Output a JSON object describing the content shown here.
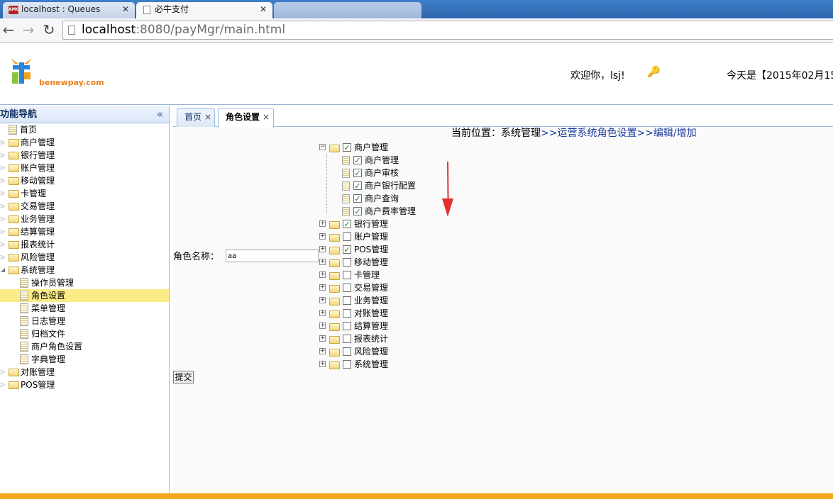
{
  "browser": {
    "tabs": [
      {
        "title": "localhost : Queues",
        "icon": "amq-icon"
      },
      {
        "title": "必牛支付",
        "icon": "page-icon"
      },
      {
        "title": "",
        "icon": "page-icon"
      }
    ],
    "url_host": "localhost",
    "url_rest": ":8080/payMgr/main.html"
  },
  "header": {
    "logo_text": "",
    "logo_url": "benewpay.com",
    "welcome": "欢迎你，lsj!",
    "date": "今天是【2015年02月15"
  },
  "sidebar": {
    "title": "功能导航",
    "items": [
      {
        "label": "首页",
        "type": "file",
        "level": 0
      },
      {
        "label": "商户管理",
        "type": "folder",
        "level": 0
      },
      {
        "label": "银行管理",
        "type": "folder",
        "level": 0
      },
      {
        "label": "账户管理",
        "type": "folder",
        "level": 0
      },
      {
        "label": "移动管理",
        "type": "folder",
        "level": 0
      },
      {
        "label": "卡管理",
        "type": "folder",
        "level": 0
      },
      {
        "label": "交易管理",
        "type": "folder",
        "level": 0
      },
      {
        "label": "业务管理",
        "type": "folder",
        "level": 0
      },
      {
        "label": "结算管理",
        "type": "folder",
        "level": 0
      },
      {
        "label": "报表统计",
        "type": "folder",
        "level": 0
      },
      {
        "label": "风险管理",
        "type": "folder",
        "level": 0
      },
      {
        "label": "系统管理",
        "type": "folder-open",
        "level": 0
      },
      {
        "label": "操作员管理",
        "type": "file",
        "level": 1
      },
      {
        "label": "角色设置",
        "type": "file",
        "level": 1,
        "selected": true
      },
      {
        "label": "菜单管理",
        "type": "file",
        "level": 1
      },
      {
        "label": "日志管理",
        "type": "file",
        "level": 1
      },
      {
        "label": "归档文件",
        "type": "file",
        "level": 1
      },
      {
        "label": "商户角色设置",
        "type": "file",
        "level": 1
      },
      {
        "label": "字典管理",
        "type": "file",
        "level": 1
      },
      {
        "label": "对账管理",
        "type": "folder",
        "level": 0
      },
      {
        "label": "POS管理",
        "type": "folder",
        "level": 0
      }
    ]
  },
  "main": {
    "tabs": [
      {
        "label": "首页",
        "close": "×"
      },
      {
        "label": "角色设置",
        "close": "×"
      }
    ],
    "breadcrumb": {
      "prefix": "当前位置：系统管理",
      "sep1": ">>",
      "link1": "运营系统角色设置",
      "sep2": ">>",
      "link2": "编辑/增加"
    },
    "role_name_label": "角色名称：",
    "role_name_value": "aa",
    "submit_label": "提交",
    "tree": [
      {
        "label": "商户管理",
        "level": 0,
        "checked": true,
        "expanded": true
      },
      {
        "label": "商户管理",
        "level": 1,
        "checked": true
      },
      {
        "label": "商户审核",
        "level": 1,
        "checked": true
      },
      {
        "label": "商户银行配置",
        "level": 1,
        "checked": true
      },
      {
        "label": "商户查询",
        "level": 1,
        "checked": true
      },
      {
        "label": "商户费率管理",
        "level": 1,
        "checked": true
      },
      {
        "label": "银行管理",
        "level": 0,
        "checked": true
      },
      {
        "label": "账户管理",
        "level": 0,
        "checked": false
      },
      {
        "label": "POS管理",
        "level": 0,
        "checked": true
      },
      {
        "label": "移动管理",
        "level": 0,
        "checked": false
      },
      {
        "label": "卡管理",
        "level": 0,
        "checked": false
      },
      {
        "label": "交易管理",
        "level": 0,
        "checked": false
      },
      {
        "label": "业务管理",
        "level": 0,
        "checked": false
      },
      {
        "label": "对账管理",
        "level": 0,
        "checked": false
      },
      {
        "label": "结算管理",
        "level": 0,
        "checked": false
      },
      {
        "label": "报表统计",
        "level": 0,
        "checked": false
      },
      {
        "label": "风险管理",
        "level": 0,
        "checked": false
      },
      {
        "label": "系统管理",
        "level": 0,
        "checked": false
      }
    ]
  },
  "colors": {
    "accent_border": "#99bbe8",
    "selected_row": "#fbec88",
    "link": "#1c3a9c",
    "bottom_bar": "#f2a81d",
    "annotation_arrow": "#e0312f"
  }
}
